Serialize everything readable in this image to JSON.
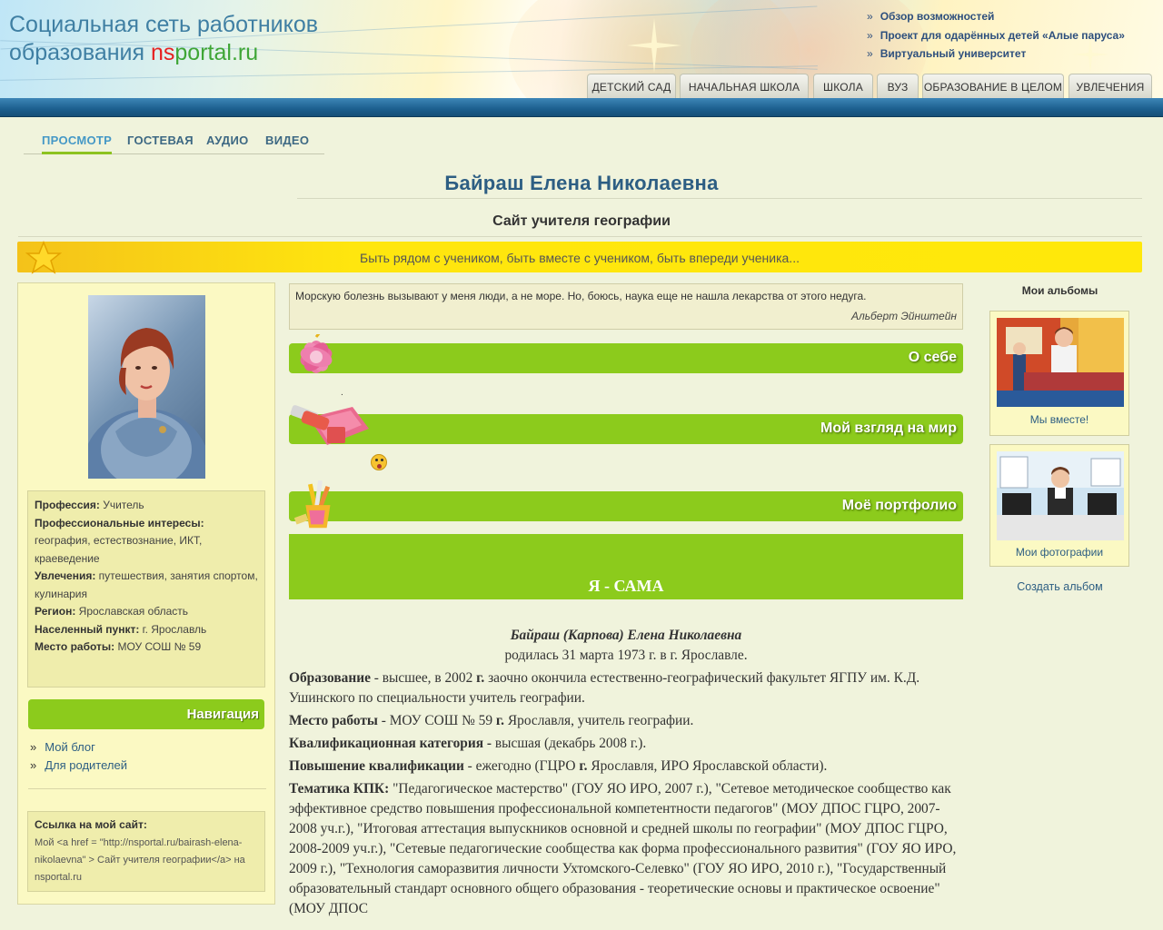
{
  "header": {
    "logo_line1": "Социальная сеть работников",
    "logo_prefix": "образования ",
    "logo_ns": "ns",
    "logo_portal": "portal.ru",
    "top_links": [
      "Обзор возможностей",
      "Проект для одарённых детей «Алые паруса»",
      "Виртуальный университет"
    ],
    "tabs": [
      "ДЕТСКИЙ САД",
      "НАЧАЛЬНАЯ ШКОЛА",
      "ШКОЛА",
      "ВУЗ",
      "ОБРАЗОВАНИЕ В ЦЕЛОМ",
      "УВЛЕЧЕНИЯ"
    ]
  },
  "subnav": [
    "ПРОСМОТР",
    "ГОСТЕВАЯ",
    "АУДИО",
    "ВИДЕО"
  ],
  "page": {
    "name": "Байраш Елена Николаевна",
    "site_title": "Сайт учителя географии",
    "motto": "Быть рядом с учеником, быть вместе с учеником, быть впереди ученика..."
  },
  "profile": {
    "profession_label": "Профессия:",
    "profession": " Учитель",
    "interests_label": "Профессиональные интересы:",
    "interests": " география, естествознание, ИКТ, краеведение",
    "hobbies_label": "Увлечения:",
    "hobbies": " путешествия, занятия спортом, кулинария",
    "region_label": "Регион:",
    "region": " Ярославская область",
    "city_label": "Населенный пункт:",
    "city": " г. Ярославль",
    "work_label": "Место работы:",
    "work": " МОУ СОШ № 59"
  },
  "navigation": {
    "title": "Навигация",
    "items": [
      "Мой блог",
      "Для родителей"
    ]
  },
  "link_box": {
    "title": "Ссылка на мой сайт:",
    "code": "Мой <a href = \"http://nsportal.ru/bairash-elena-nikolaevna\" > Сайт учителя географии</a> на nsportal.ru"
  },
  "quote": {
    "text": "Морскую болезнь вызывают у меня люди, а не море. Но, боюсь, наука еще не нашла лекарства от этого недуга.",
    "author": "Альберт Эйнштейн"
  },
  "sections": {
    "about": "О себе",
    "about_dot": ".",
    "worldview": "Мой взгляд на мир",
    "portfolio": "Моё портфолио"
  },
  "portfolio": {
    "heading": "Я - САМА",
    "full_name": "Байраш (Карпова) Елена Николаевна",
    "born": "родилась 31 марта 1973 г. в г. Ярославле.",
    "education_label": "Образование",
    "education": " - высшее, в 2002 ",
    "education_g": "г.",
    "education_rest": " заочно окончила естественно-географический факультет ЯГПУ им. К.Д. Ушинского по специальности учитель географии.",
    "work_label": "Место работы",
    "work_a": " - МОУ  СОШ № 59 ",
    "work_b": "г.",
    "work_c": " Ярославля, учитель географии.",
    "category_label": "Квалификационная категория -",
    "category": " высшая (декабрь 2008 г.).",
    "training_label": "Повышение квалификации",
    "training_a": " - ежегодно (ГЦРО ",
    "training_b": "г.",
    "training_c": " Ярославля, ИРО Ярославской области).",
    "topics_label": "Тематика КПК:",
    "topics": " \"Педагогическое мастерство\" (ГОУ ЯО ИРО, 2007 г.), \"Сетевое методическое сообщество как эффективное средство повышения профессиональной компетентности педагогов\" (МОУ ДПОС ГЦРО, 2007-2008 уч.г.), \"Итоговая аттестация выпускников основной и средней школы по географии\" (МОУ ДПОС ГЦРО, 2008-2009 уч.г.), \"Сетевые педагогические сообщества как форма профессионального развития\" (ГОУ ЯО ИРО, 2009 г.), \"Технология саморазвития личности Ухтомского-Селевко\" (ГОУ ЯО ИРО, 2010 г.), \"Государственный образовательный стандарт основного общего образования - теоретические основы и практическое освоение\" (МОУ ДПОС"
  },
  "albums": {
    "title": "Мои альбомы",
    "items": [
      "Мы вместе!",
      "Мои фотографии"
    ],
    "create": "Создать альбом"
  },
  "colors": {
    "green": "#8ccb1c",
    "blue_bar": "#1c5f8e",
    "link_blue": "#2d5e83",
    "motto_yellow": "#ffe60e",
    "panel_yellow": "#fbf9c3"
  }
}
